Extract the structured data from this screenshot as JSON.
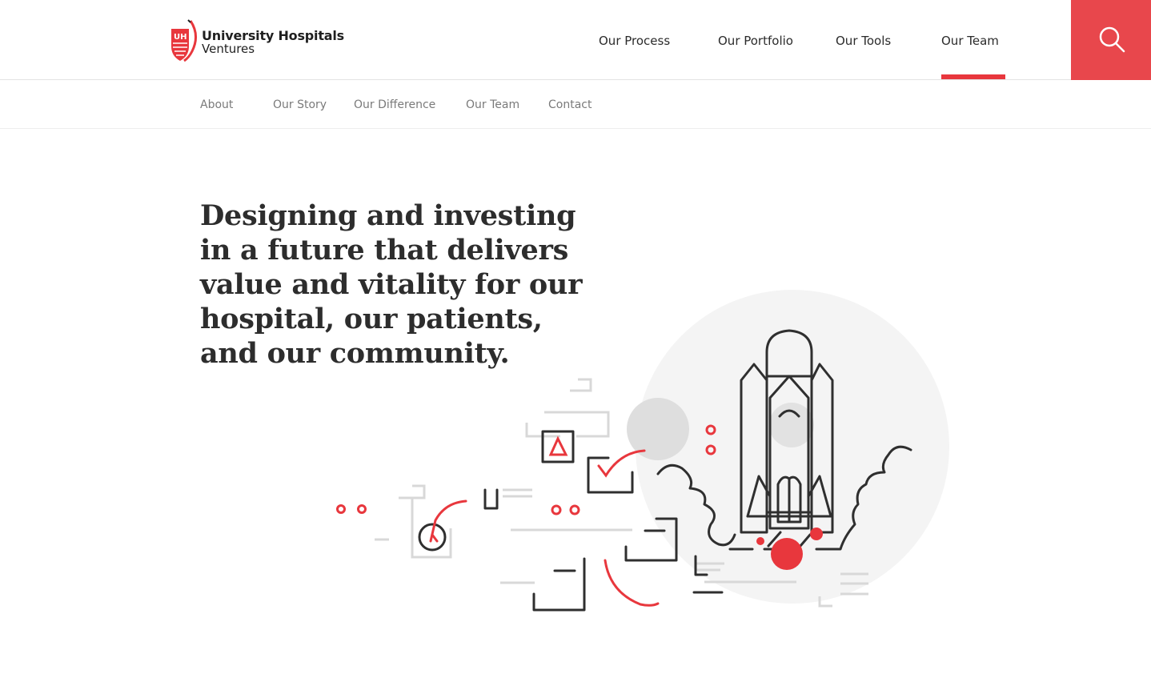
{
  "brand": {
    "logo_badge": "UH",
    "name_line1": "University Hospitals",
    "name_line2": "Ventures"
  },
  "main_nav": {
    "items": [
      "Our Process",
      "Our Portfolio",
      "Our Tools",
      "Our Team"
    ],
    "active": "Our Team"
  },
  "search": {
    "icon": "search-icon"
  },
  "sub_nav": {
    "items": [
      "About",
      "Our Story",
      "Our Difference",
      "Our Team",
      "Contact"
    ]
  },
  "hero": {
    "headline": "Designing and investing in a future that delivers value and vitality for our hospital, our patients, and our community.",
    "illustration": "rocket-launch-illustration"
  },
  "colors": {
    "accent": "#e8474c",
    "text": "#2d2d2d",
    "subnav_text": "#7a7a7a",
    "light_gray": "#f2f2f2"
  }
}
